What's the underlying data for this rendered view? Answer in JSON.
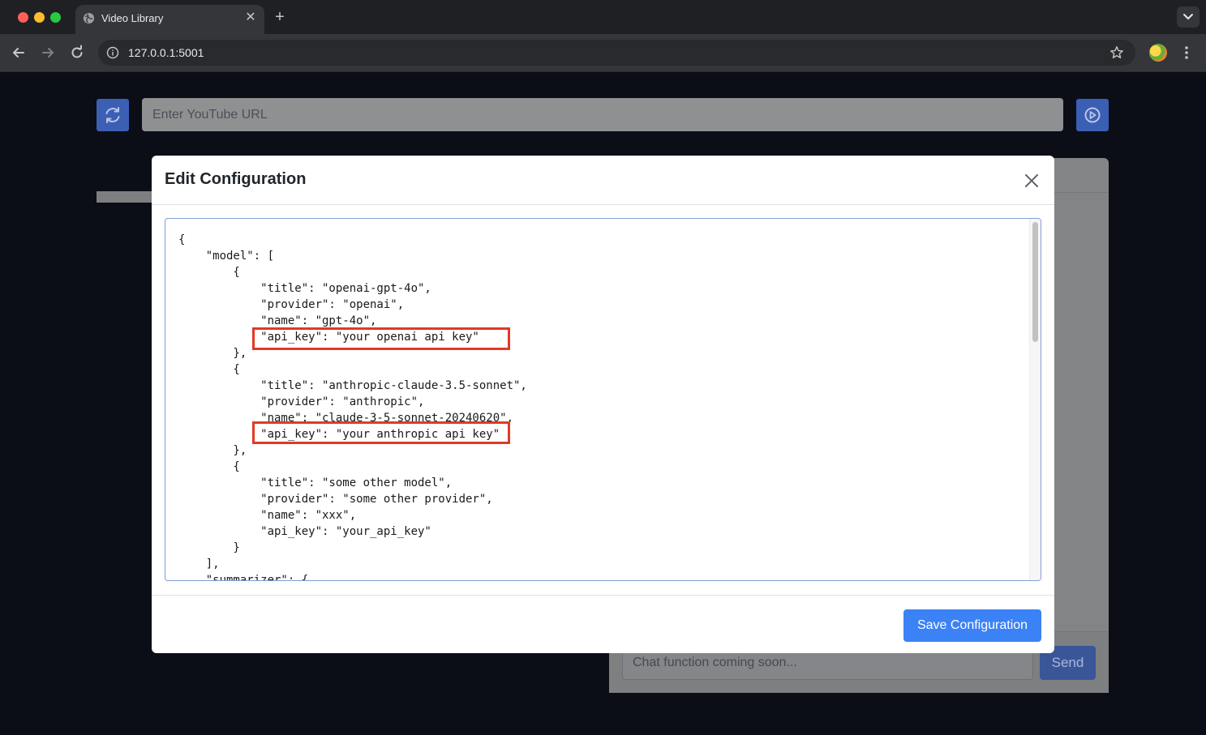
{
  "browser": {
    "tab_title": "Video Library",
    "new_tab_symbol": "+",
    "close_symbol": "✕",
    "url": "127.0.0.1:5001",
    "icons": [
      "globe-icon",
      "back-icon",
      "forward-icon",
      "reload-icon",
      "info-icon",
      "star-icon",
      "profile-avatar",
      "more-menu-icon",
      "tab-search-icon"
    ]
  },
  "page": {
    "youtube_placeholder": "Enter YouTube URL",
    "chat_placeholder": "Chat function coming soon...",
    "send_label": "Send",
    "accent_color": "#3b5fb4"
  },
  "modal": {
    "title": "Edit Configuration",
    "save_label": "Save Configuration",
    "highlight_color": "#e03a25",
    "config_lines": [
      "{",
      "    \"model\": [",
      "        {",
      "            \"title\": \"openai-gpt-4o\",",
      "            \"provider\": \"openai\",",
      "            \"name\": \"gpt-4o\",",
      "            \"api_key\": \"your openai api key\"",
      "        },",
      "        {",
      "            \"title\": \"anthropic-claude-3.5-sonnet\",",
      "            \"provider\": \"anthropic\",",
      "            \"name\": \"claude-3-5-sonnet-20240620\",",
      "            \"api_key\": \"your anthropic api key\"",
      "        },",
      "        {",
      "            \"title\": \"some other model\",",
      "            \"provider\": \"some other provider\",",
      "            \"name\": \"xxx\",",
      "            \"api_key\": \"your_api_key\"",
      "        }",
      "    ],",
      "    \"summarizer\": {"
    ]
  }
}
